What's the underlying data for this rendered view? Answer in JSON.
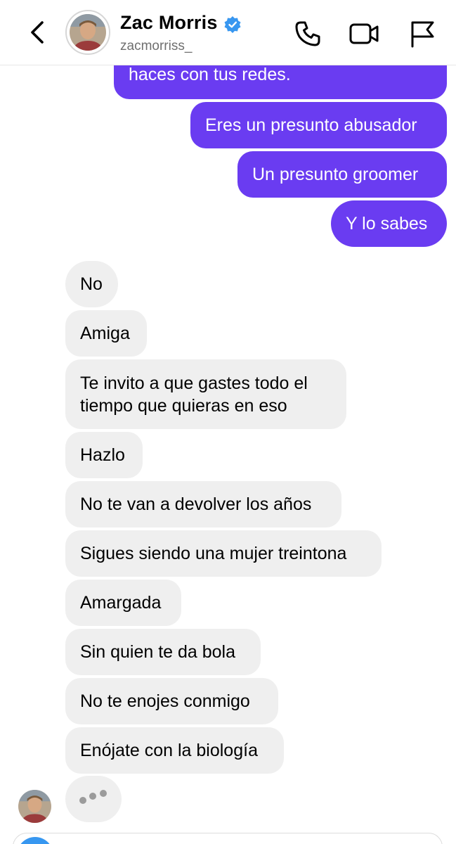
{
  "header": {
    "name": "Zac Morris",
    "handle": "zacmorriss_",
    "verified_color": "#3897f0"
  },
  "icons": {
    "back": "chevron-left-icon",
    "phone": "phone-icon",
    "video": "video-camera-icon",
    "flag": "flag-icon"
  },
  "colors": {
    "sent_bubble": "#6a3cf1",
    "received_bubble": "#efefef"
  },
  "messages": {
    "sent": [
      "haces con tus redes.",
      "Eres un presunto abusador",
      "Un presunto groomer",
      "Y lo sabes"
    ],
    "received": [
      "No",
      "Amiga",
      "Te invito a que gastes todo el tiempo que quieras en eso",
      "Hazlo",
      "No te van a devolver los años",
      "Sigues siendo una mujer treintona",
      "Amargada",
      "Sin quien te da bola",
      "No te enojes conmigo",
      "Enójate con la biología"
    ]
  }
}
